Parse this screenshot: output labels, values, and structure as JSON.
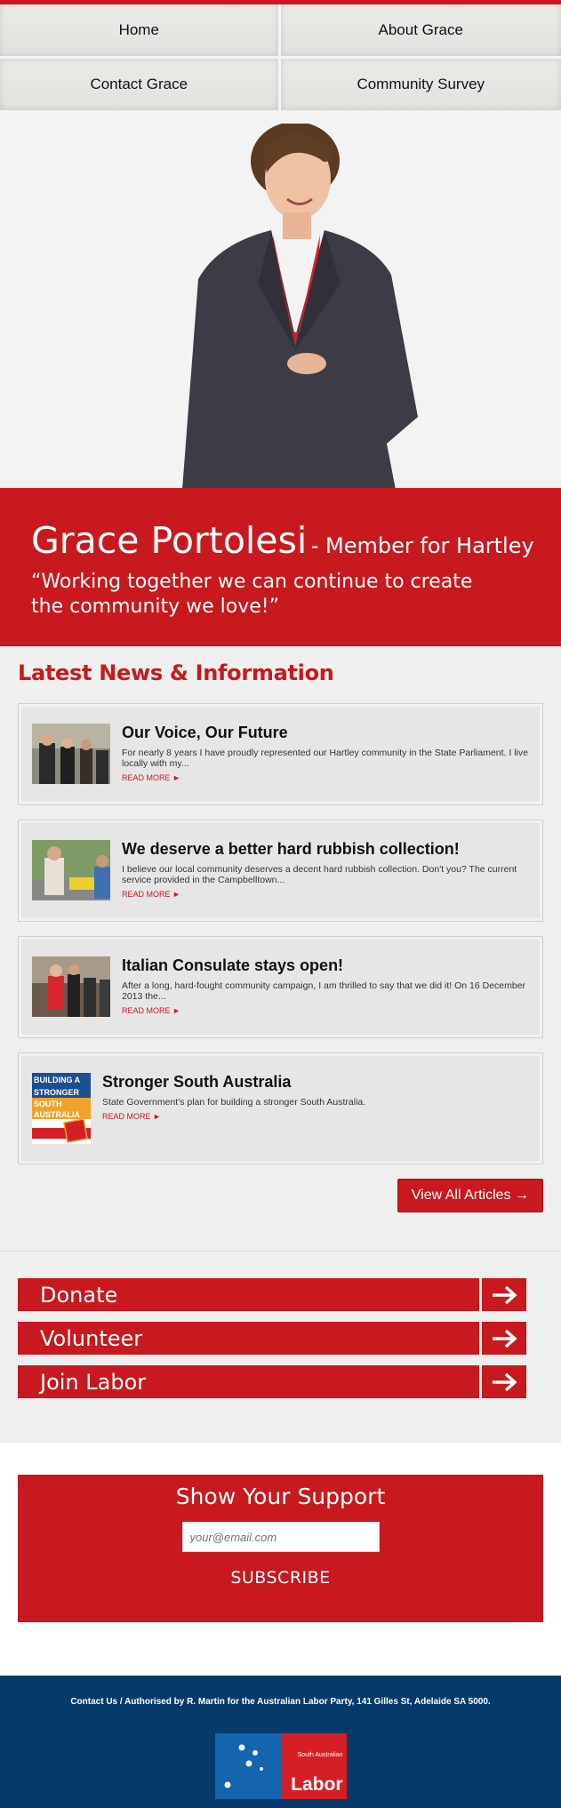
{
  "nav": {
    "items": [
      {
        "label": "Home"
      },
      {
        "label": "About Grace"
      },
      {
        "label": "Contact Grace"
      },
      {
        "label": "Community Survey"
      }
    ]
  },
  "banner": {
    "name": "Grace Portolesi",
    "role": "- Member for Hartley",
    "quote": "“Working together we can continue to create the community we love!”"
  },
  "news": {
    "title": "Latest News & Information",
    "articles": [
      {
        "title": "Our Voice, Our Future",
        "excerpt": "For nearly 8 years I have proudly represented our Hartley community in the State Parliament. I live locally with my...",
        "more": "READ MORE ►"
      },
      {
        "title": "We deserve a better hard rubbish collection!",
        "excerpt": "I believe our local community deserves a decent hard rubbish collection. Don't you? The current service provided in the Campbelltown...",
        "more": "READ MORE ►"
      },
      {
        "title": "Italian Consulate stays open!",
        "excerpt": "After a long, hard-fought community campaign, I am thrilled to say that we did it! On 16 December 2013 the...",
        "more": "READ MORE ►"
      },
      {
        "title": "Stronger South Australia",
        "excerpt": "State Government's plan for building a stronger South Australia.",
        "more": "READ MORE ►"
      }
    ],
    "thumb4_lines": [
      "BUILDING A",
      "STRONGER",
      "SOUTH",
      "AUSTRALIA"
    ],
    "view_all": "View All Articles →"
  },
  "cta": [
    {
      "label": "Donate"
    },
    {
      "label": "Volunteer"
    },
    {
      "label": "Join Labor"
    }
  ],
  "support": {
    "title": "Show Your Support",
    "placeholder": "your@email.com",
    "button": "SUBSCRIBE"
  },
  "footer": {
    "text": "Contact Us / Authorised by R. Martin for the Australian Labor Party, 141 Gilles St, Adelaide SA 5000.",
    "logo_small": "South Australian",
    "logo_big": "Labor"
  },
  "colors": {
    "brand_red": "#c8191f",
    "footer_blue": "#063a6b"
  }
}
